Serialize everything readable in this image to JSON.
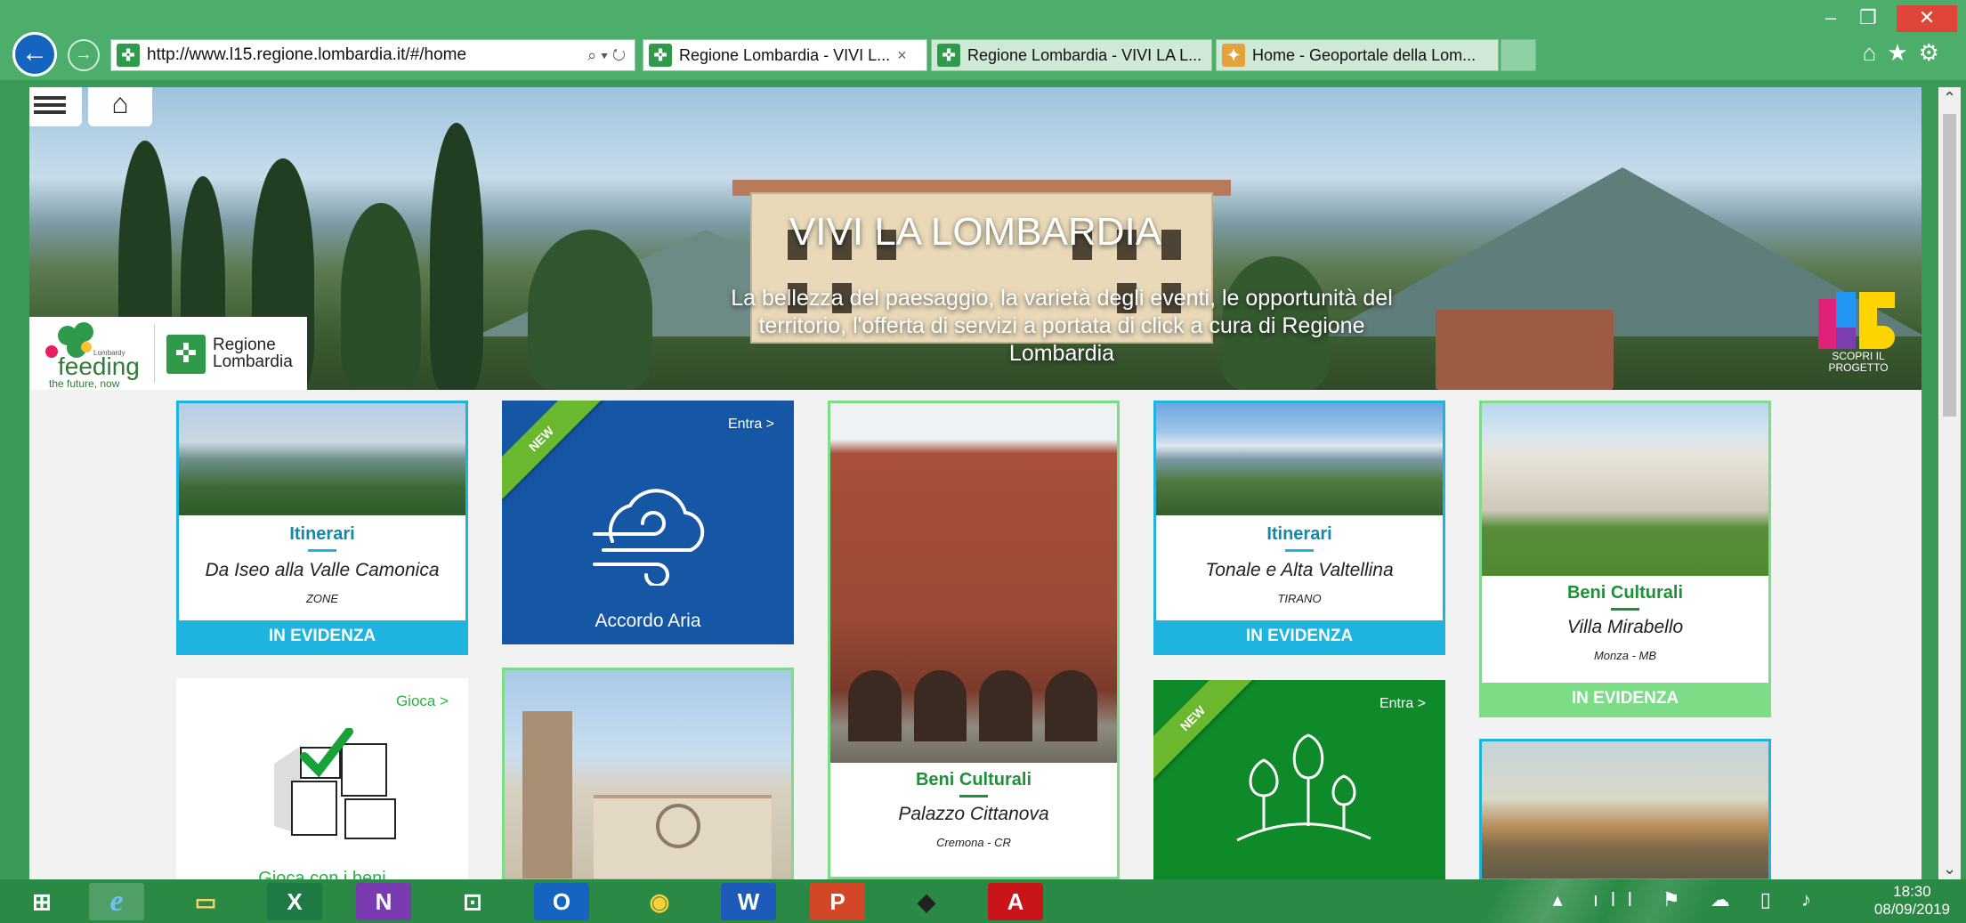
{
  "browser": {
    "url": "http://www.l15.regione.lombardia.it/#/home",
    "address_icons": "⌕ ▾ ↻",
    "tabs": [
      {
        "title": "Regione Lombardia - VIVI L...",
        "active": true,
        "closable": true
      },
      {
        "title": "Regione Lombardia - VIVI LA L...",
        "active": false,
        "closable": false
      },
      {
        "title": "Home - Geoportale della Lom...",
        "active": false,
        "closable": false
      }
    ],
    "tab_close_glyph": "×",
    "window_controls": {
      "minimize": "–",
      "maximize": "❐",
      "close": "✕"
    },
    "toolbar_icons": [
      "home-icon",
      "star-icon",
      "gear-icon"
    ],
    "toolbar_glyphs": "⌂★⚙"
  },
  "hero": {
    "title": "VIVI LA LOMBARDIA",
    "subtitle": "La bellezza del paesaggio, la varietà degli eventi, le opportunità del territorio, l'offerta di servizi a portata di click a cura di Regione Lombardia",
    "home_glyph": "⌂",
    "logo_feeding": {
      "small": "Lombardy",
      "main": "feeding",
      "tagline": "the future, now"
    },
    "logo_regione": {
      "line1": "Regione",
      "line2": "Lombardia"
    },
    "l15_cta": {
      "line1": "SCOPRI IL",
      "line2": "PROGETTO"
    }
  },
  "cards": {
    "iseo": {
      "category": "Itinerari",
      "title": "Da Iseo alla Valle Camonica",
      "location": "ZONE",
      "band": "IN EVIDENZA"
    },
    "aria": {
      "ribbon": "NEW",
      "entra": "Entra >",
      "title": "Accordo Aria"
    },
    "cittanova": {
      "category": "Beni Culturali",
      "title": "Palazzo Cittanova",
      "location": "Cremona - CR"
    },
    "tonale": {
      "category": "Itinerari",
      "title": "Tonale e Alta Valtellina",
      "location": "TIRANO",
      "band": "IN EVIDENZA"
    },
    "mirabello": {
      "category": "Beni Culturali",
      "title": "Villa Mirabello",
      "location": "Monza - MB",
      "band": "IN EVIDENZA"
    },
    "gioca": {
      "link": "Gioca >",
      "title": "Gioca con i beni"
    },
    "parks": {
      "ribbon": "NEW",
      "entra": "Entra >"
    }
  },
  "taskbar": {
    "apps": [
      "windows-start",
      "internet-explorer",
      "file-explorer",
      "excel",
      "onenote",
      "store",
      "outlook",
      "chrome",
      "word",
      "powerpoint",
      "graduation-app",
      "acrobat"
    ],
    "glyphs": {
      "start": "⊞",
      "ie": "e",
      "explorer": "▭",
      "excel": "X",
      "onenote": "N",
      "store": "⊡",
      "outlook": "O",
      "chrome": "◉",
      "word": "W",
      "powerpoint": "P",
      "grad": "◆",
      "acrobat": "A"
    },
    "tray_glyphs": "▴ ıll ⚑ ☁ ▯ ♪",
    "time": "18:30",
    "date": "08/09/2019"
  },
  "scrollbar": {
    "up": "⌃",
    "down": "⌄"
  },
  "colors": {
    "accent_green": "#3a9a57",
    "accent_blue": "#1fb3e0",
    "card_green": "#7ddc86",
    "aria_blue": "#1557a4",
    "parks_green": "#0e8a2a"
  }
}
